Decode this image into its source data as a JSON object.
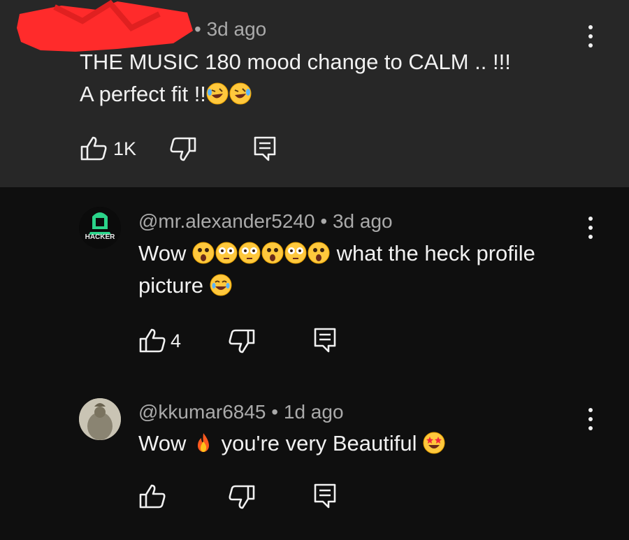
{
  "comment_top": {
    "timestamp": "• 3d ago",
    "line1": "THE MUSIC 180 mood  change to CALM .. !!!",
    "line2": "A perfect fit !!",
    "like_count": "1K"
  },
  "reply1": {
    "author": "@mr.alexander5240",
    "timestamp": "• 3d ago",
    "avatar_text": "HACKER",
    "text_wow": "Wow",
    "text_after": "what the heck profile",
    "line2": "picture",
    "like_count": "4"
  },
  "reply2": {
    "author": "@kkumar6845",
    "timestamp": "• 1d ago",
    "text_wow": "Wow",
    "text_after": "you're very Beautiful"
  },
  "icons": {
    "like": "thumbs-up-icon",
    "dislike": "thumbs-down-icon",
    "reply": "reply-comment-icon",
    "more": "more-vert-icon"
  },
  "colors": {
    "background": "#0f0f0f",
    "highlight_panel": "#272727",
    "redaction": "#ff2b2b",
    "secondary_text": "#aaaaaa"
  }
}
